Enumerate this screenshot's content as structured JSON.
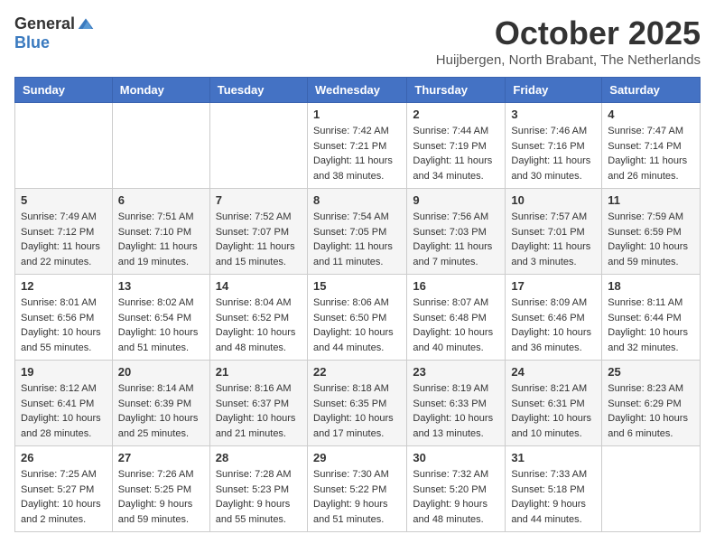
{
  "header": {
    "logo_general": "General",
    "logo_blue": "Blue",
    "month_title": "October 2025",
    "location": "Huijbergen, North Brabant, The Netherlands"
  },
  "days_of_week": [
    "Sunday",
    "Monday",
    "Tuesday",
    "Wednesday",
    "Thursday",
    "Friday",
    "Saturday"
  ],
  "weeks": [
    [
      {
        "day": "",
        "info": ""
      },
      {
        "day": "",
        "info": ""
      },
      {
        "day": "",
        "info": ""
      },
      {
        "day": "1",
        "info": "Sunrise: 7:42 AM\nSunset: 7:21 PM\nDaylight: 11 hours\nand 38 minutes."
      },
      {
        "day": "2",
        "info": "Sunrise: 7:44 AM\nSunset: 7:19 PM\nDaylight: 11 hours\nand 34 minutes."
      },
      {
        "day": "3",
        "info": "Sunrise: 7:46 AM\nSunset: 7:16 PM\nDaylight: 11 hours\nand 30 minutes."
      },
      {
        "day": "4",
        "info": "Sunrise: 7:47 AM\nSunset: 7:14 PM\nDaylight: 11 hours\nand 26 minutes."
      }
    ],
    [
      {
        "day": "5",
        "info": "Sunrise: 7:49 AM\nSunset: 7:12 PM\nDaylight: 11 hours\nand 22 minutes."
      },
      {
        "day": "6",
        "info": "Sunrise: 7:51 AM\nSunset: 7:10 PM\nDaylight: 11 hours\nand 19 minutes."
      },
      {
        "day": "7",
        "info": "Sunrise: 7:52 AM\nSunset: 7:07 PM\nDaylight: 11 hours\nand 15 minutes."
      },
      {
        "day": "8",
        "info": "Sunrise: 7:54 AM\nSunset: 7:05 PM\nDaylight: 11 hours\nand 11 minutes."
      },
      {
        "day": "9",
        "info": "Sunrise: 7:56 AM\nSunset: 7:03 PM\nDaylight: 11 hours\nand 7 minutes."
      },
      {
        "day": "10",
        "info": "Sunrise: 7:57 AM\nSunset: 7:01 PM\nDaylight: 11 hours\nand 3 minutes."
      },
      {
        "day": "11",
        "info": "Sunrise: 7:59 AM\nSunset: 6:59 PM\nDaylight: 10 hours\nand 59 minutes."
      }
    ],
    [
      {
        "day": "12",
        "info": "Sunrise: 8:01 AM\nSunset: 6:56 PM\nDaylight: 10 hours\nand 55 minutes."
      },
      {
        "day": "13",
        "info": "Sunrise: 8:02 AM\nSunset: 6:54 PM\nDaylight: 10 hours\nand 51 minutes."
      },
      {
        "day": "14",
        "info": "Sunrise: 8:04 AM\nSunset: 6:52 PM\nDaylight: 10 hours\nand 48 minutes."
      },
      {
        "day": "15",
        "info": "Sunrise: 8:06 AM\nSunset: 6:50 PM\nDaylight: 10 hours\nand 44 minutes."
      },
      {
        "day": "16",
        "info": "Sunrise: 8:07 AM\nSunset: 6:48 PM\nDaylight: 10 hours\nand 40 minutes."
      },
      {
        "day": "17",
        "info": "Sunrise: 8:09 AM\nSunset: 6:46 PM\nDaylight: 10 hours\nand 36 minutes."
      },
      {
        "day": "18",
        "info": "Sunrise: 8:11 AM\nSunset: 6:44 PM\nDaylight: 10 hours\nand 32 minutes."
      }
    ],
    [
      {
        "day": "19",
        "info": "Sunrise: 8:12 AM\nSunset: 6:41 PM\nDaylight: 10 hours\nand 28 minutes."
      },
      {
        "day": "20",
        "info": "Sunrise: 8:14 AM\nSunset: 6:39 PM\nDaylight: 10 hours\nand 25 minutes."
      },
      {
        "day": "21",
        "info": "Sunrise: 8:16 AM\nSunset: 6:37 PM\nDaylight: 10 hours\nand 21 minutes."
      },
      {
        "day": "22",
        "info": "Sunrise: 8:18 AM\nSunset: 6:35 PM\nDaylight: 10 hours\nand 17 minutes."
      },
      {
        "day": "23",
        "info": "Sunrise: 8:19 AM\nSunset: 6:33 PM\nDaylight: 10 hours\nand 13 minutes."
      },
      {
        "day": "24",
        "info": "Sunrise: 8:21 AM\nSunset: 6:31 PM\nDaylight: 10 hours\nand 10 minutes."
      },
      {
        "day": "25",
        "info": "Sunrise: 8:23 AM\nSunset: 6:29 PM\nDaylight: 10 hours\nand 6 minutes."
      }
    ],
    [
      {
        "day": "26",
        "info": "Sunrise: 7:25 AM\nSunset: 5:27 PM\nDaylight: 10 hours\nand 2 minutes."
      },
      {
        "day": "27",
        "info": "Sunrise: 7:26 AM\nSunset: 5:25 PM\nDaylight: 9 hours\nand 59 minutes."
      },
      {
        "day": "28",
        "info": "Sunrise: 7:28 AM\nSunset: 5:23 PM\nDaylight: 9 hours\nand 55 minutes."
      },
      {
        "day": "29",
        "info": "Sunrise: 7:30 AM\nSunset: 5:22 PM\nDaylight: 9 hours\nand 51 minutes."
      },
      {
        "day": "30",
        "info": "Sunrise: 7:32 AM\nSunset: 5:20 PM\nDaylight: 9 hours\nand 48 minutes."
      },
      {
        "day": "31",
        "info": "Sunrise: 7:33 AM\nSunset: 5:18 PM\nDaylight: 9 hours\nand 44 minutes."
      },
      {
        "day": "",
        "info": ""
      }
    ]
  ]
}
